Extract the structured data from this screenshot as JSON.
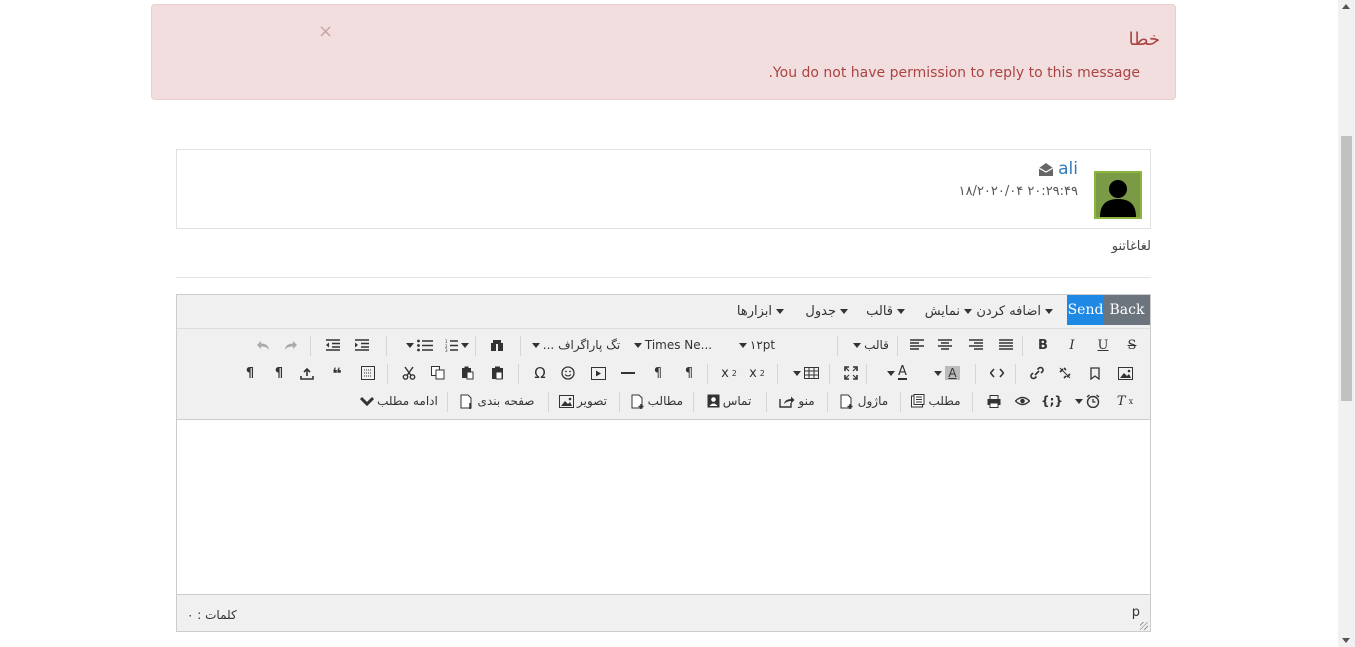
{
  "alert": {
    "title": "خطا",
    "text": ".You do not have permission to reply to this message",
    "close": "×",
    "bg_color": "#f2dede",
    "text_color": "#a94442"
  },
  "message": {
    "sender": "ali",
    "date": "۱۸/۲۰۲۰/۰۴ ۲۰:۲۹:۴۹",
    "body": "لغاغاتنو",
    "icons": [
      "envelope-open-icon",
      "avatar-icon"
    ]
  },
  "editor": {
    "buttons": {
      "back": "Back",
      "send": "Send"
    },
    "menus": [
      "اضافه کردن",
      "نمایش",
      "قالب",
      "جدول",
      "ابزارها"
    ],
    "dropdowns": {
      "format": "قالب",
      "font_size": "۱۲pt",
      "font_family": "Times Ne...",
      "block": "... تگ پاراگراف"
    },
    "plugin_buttons": {
      "content": "مطلب",
      "module": "ماژول",
      "menu": "منو",
      "contact": "تماس",
      "articles": "مطالب",
      "image": "تصویر",
      "pagebreak": "صفحه بندی",
      "readmore": "ادامه مطلب"
    },
    "status": {
      "words": "کلمات : ۰",
      "path": "p"
    },
    "accent_color": "#1e88e5",
    "back_color": "#6c757d"
  }
}
